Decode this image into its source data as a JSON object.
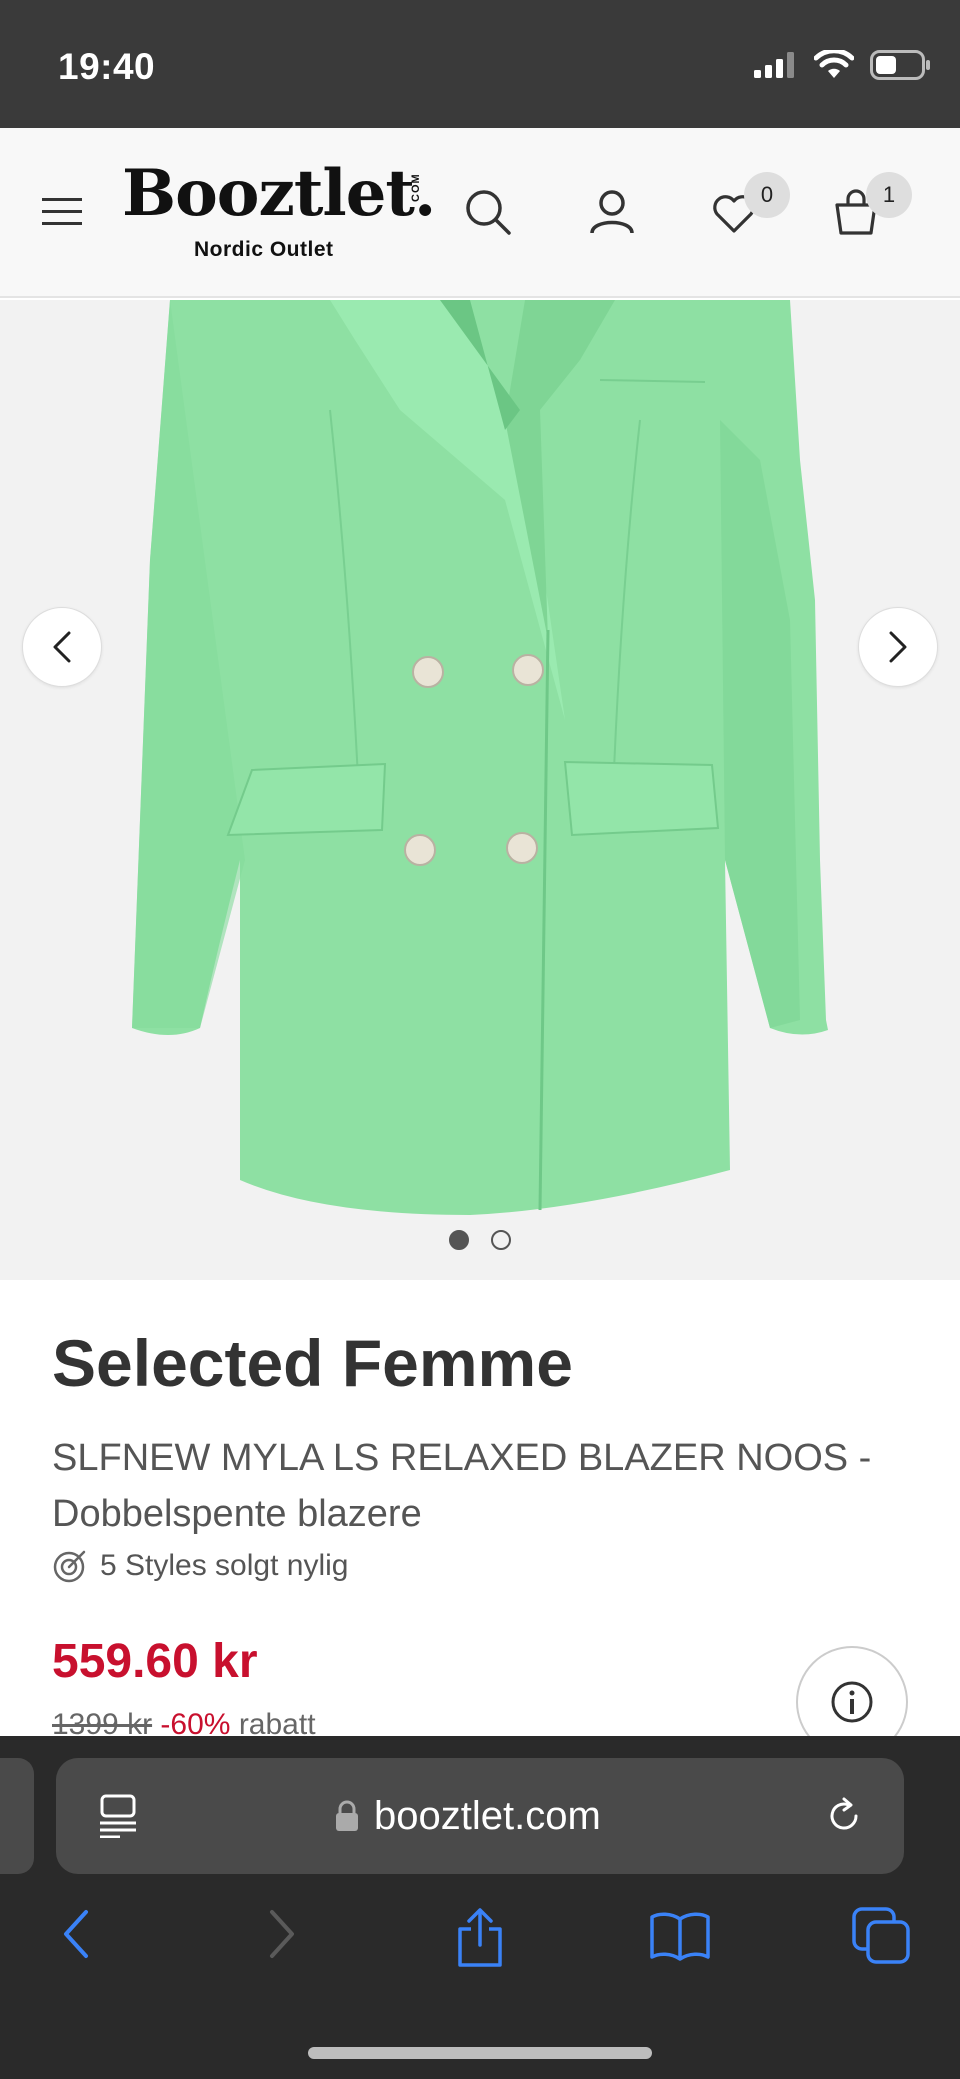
{
  "status_bar": {
    "time": "19:40"
  },
  "header": {
    "logo_text": "Booztlet.",
    "logo_com": "COM",
    "logo_tagline": "Nordic Outlet",
    "wishlist_count": "0",
    "cart_count": "1"
  },
  "gallery": {
    "image_count": 2,
    "active_index": 0
  },
  "product": {
    "brand": "Selected Femme",
    "name": "SLFNEW MYLA LS RELAXED BLAZER NOOS - Dobbelspente blazere",
    "sold_recently": "5 Styles solgt nylig",
    "price": "559.60 kr",
    "old_price": "1399 kr",
    "discount": "-60%",
    "discount_suffix": "rabatt"
  },
  "browser": {
    "url": "booztlet.com"
  },
  "colors": {
    "accent_red": "#c8102e",
    "blazer_green": "#8ee0a3",
    "ios_blue": "#3a82f7"
  }
}
